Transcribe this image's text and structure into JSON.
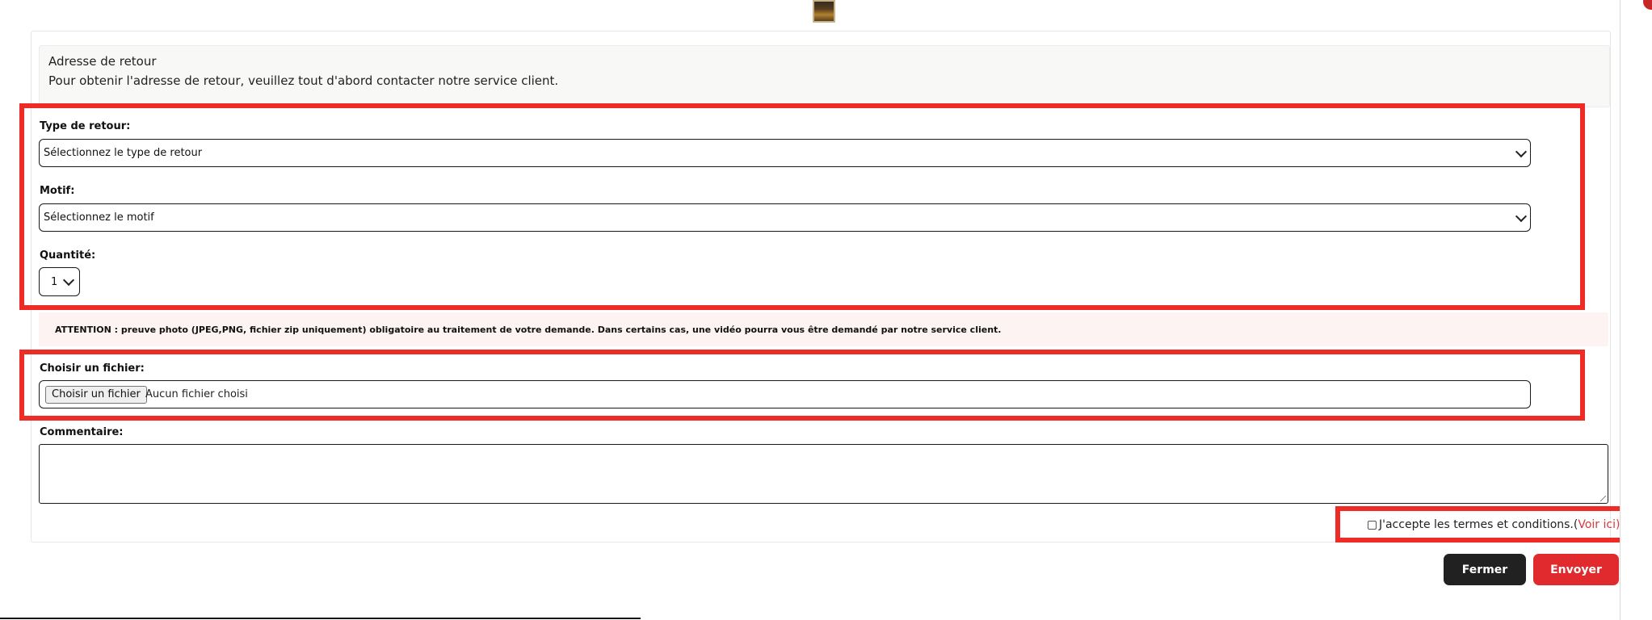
{
  "address": {
    "title": "Adresse de retour",
    "text": "Pour obtenir l'adresse de retour, veuillez tout d'abord contacter notre service client."
  },
  "form": {
    "return_type": {
      "label": "Type de retour:",
      "selected": "Sélectionnez le type de retour"
    },
    "reason": {
      "label": "Motif:",
      "selected": "Sélectionnez le motif"
    },
    "quantity": {
      "label": "Quantité:",
      "selected": "1"
    },
    "attention": "ATTENTION : preuve photo (JPEG,PNG, fichier zip uniquement) obligatoire au traitement de votre demande. Dans certains cas, une vidéo pourra vous être demandé par notre service client.",
    "file": {
      "label": "Choisir un fichier:",
      "button": "Choisir un fichier",
      "status": "Aucun fichier choisi"
    },
    "comment": {
      "label": "Commentaire:"
    },
    "terms": {
      "text": "J'accepte les termes et conditions.(",
      "link": "Voir ici",
      "suffix": ")"
    }
  },
  "buttons": {
    "close": "Fermer",
    "send": "Envoyer"
  },
  "colors": {
    "highlight": "#ef2b25",
    "send_button": "#e02a2d",
    "close_button": "#212121",
    "link": "#d73a3a"
  }
}
